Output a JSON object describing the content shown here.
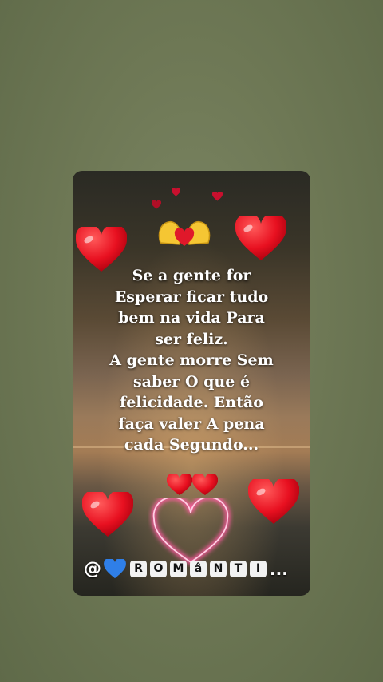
{
  "quote_lines": [
    "Se a gente for",
    "Esperar ficar tudo",
    "bem na vida Para",
    "ser feliz.",
    "A gente morre Sem",
    "saber O que é",
    "felicidade. Então",
    "faça valer A pena",
    "cada Segundo..."
  ],
  "handle": {
    "at": "@",
    "letters": [
      "R",
      "O",
      "M",
      "â",
      "N",
      "T",
      "I"
    ],
    "ellipsis": "..."
  },
  "colors": {
    "heart": "#e81020",
    "heart_outline_glow": "#ff6fa0",
    "handle_heart": "#2f7fe8"
  },
  "icons": [
    "red-heart-icon",
    "heart-hands-icon",
    "blue-heart-icon",
    "glowing-heart-outline-icon"
  ]
}
